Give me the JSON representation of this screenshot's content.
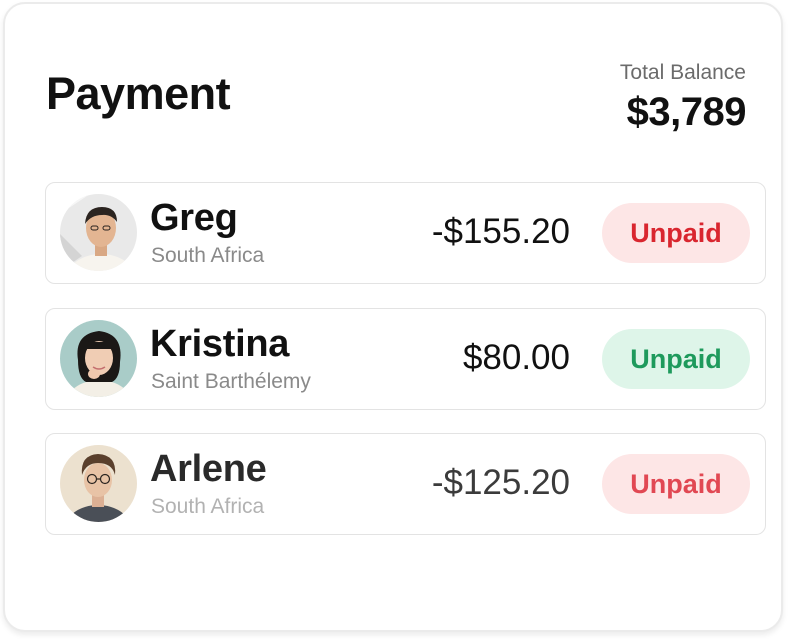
{
  "header": {
    "title": "Payment",
    "balance_label": "Total Balance",
    "balance_value": "$3,789"
  },
  "colors": {
    "unpaid_red_text": "#d9262f",
    "unpaid_red_bg": "#fde6e6",
    "unpaid_green_text": "#1e9a5c",
    "unpaid_green_bg": "#def5e9"
  },
  "payments": [
    {
      "name": "Greg",
      "country": "South Africa",
      "amount": "-$155.20",
      "status": "Unpaid",
      "status_color": "red"
    },
    {
      "name": "Kristina",
      "country": "Saint Barthélemy",
      "amount": "$80.00",
      "status": "Unpaid",
      "status_color": "green"
    },
    {
      "name": "Arlene",
      "country": "South Africa",
      "amount": "-$125.20",
      "status": "Unpaid",
      "status_color": "red"
    }
  ]
}
